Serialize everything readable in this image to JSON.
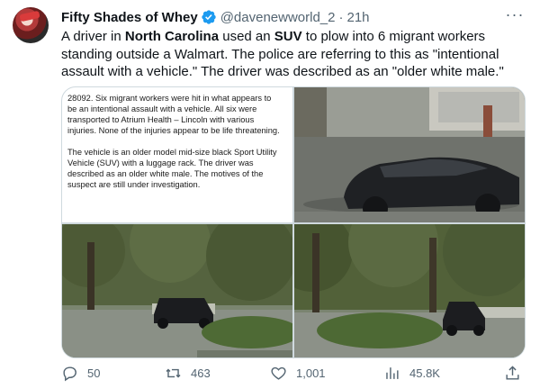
{
  "author": {
    "name": "Fifty Shades of Whey",
    "handle": "@davenewworld_2",
    "separator": "·",
    "time": "21h"
  },
  "tweet_text": {
    "p1": "A driver in ",
    "b1": "North Carolina",
    "p2": " used an ",
    "b2": "SUV",
    "p3": " to plow into 6 migrant workers standing outside a Walmart. The police are referring to this as \"intentional assault with a vehicle.\" The driver was described as an \"older white male.\""
  },
  "news_excerpt": {
    "para1": "28092. Six migrant workers were hit in what appears to be an intentional assault with a vehicle. All six were transported to Atrium Health – Lincoln with various injuries. None of the injuries appear to be life threatening.",
    "para2": "The vehicle is an older model mid-size black Sport Utility Vehicle (SUV) with a luggage rack. The driver was described as an older white male. The motives of the suspect are still under investigation."
  },
  "actions": {
    "replies": "50",
    "retweets": "463",
    "likes": "1,001",
    "views": "45.8K"
  },
  "colors": {
    "verified": "#1d9bf0",
    "secondary_text": "#536471",
    "border": "#cfd9de"
  },
  "icons": [
    "more-icon",
    "verified-badge-icon",
    "reply-icon",
    "retweet-icon",
    "like-icon",
    "views-icon",
    "share-icon"
  ]
}
